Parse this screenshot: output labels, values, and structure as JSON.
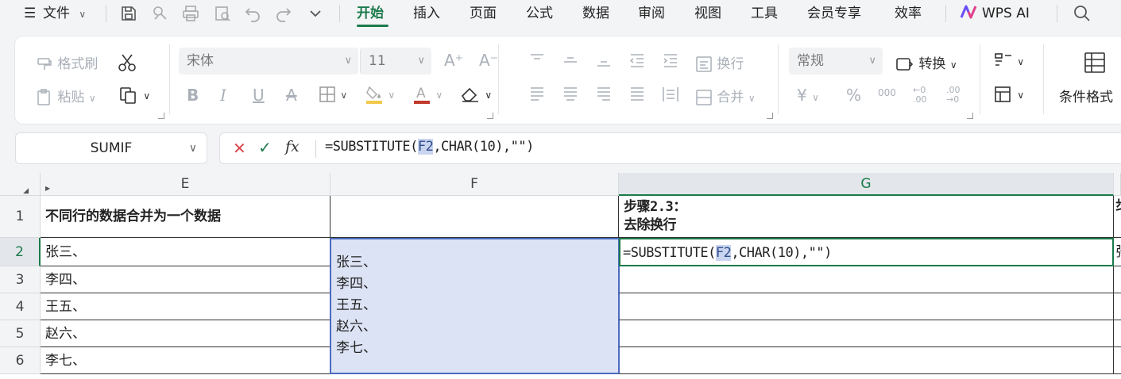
{
  "menubar": {
    "hamburger": "☰",
    "file": "文件",
    "tabs": [
      "开始",
      "插入",
      "页面",
      "公式",
      "数据",
      "审阅",
      "视图",
      "工具",
      "会员专享",
      "效率"
    ],
    "wps_ai": "WPS AI",
    "accent": "#1b7a4a"
  },
  "ribbon": {
    "format_painter": "格式刷",
    "paste": "粘贴",
    "font_name": "宋体",
    "font_size": "11",
    "wrap": "换行",
    "merge": "合并",
    "number_format": "常规",
    "convert": "转换",
    "conditional_format": "条件格式",
    "bold": "B",
    "italic": "I",
    "underline": "U",
    "strike": "A",
    "font_grow": "A⁺",
    "font_shrink": "A⁻",
    "currency": "¥",
    "percent": "%",
    "thousands": "000",
    "dec_inc": "←0 .00",
    "dec_dec": ".00 →0"
  },
  "namebox": {
    "value": "SUMIF"
  },
  "formula": {
    "p1": "=SUBSTITUTE(",
    "ref": "F2",
    "p2": ",CHAR(10),\"\")"
  },
  "columns": [
    "E",
    "F",
    "G"
  ],
  "rows": [
    "1",
    "2",
    "3",
    "4",
    "5",
    "6"
  ],
  "cells": {
    "E1": "不同行的数据合并为一个数据",
    "E2": "张三、",
    "E3": "李四、",
    "E4": "王五、",
    "E5": "赵六、",
    "E6": "李七、",
    "F2": [
      "张三、",
      "李四、",
      "王五、",
      "赵六、",
      "李七、"
    ],
    "G1_line1": "步骤2.3：",
    "G1_line2": "去除换行",
    "G2_p1": "=SUBSTITUTE(",
    "G2_ref": "F2",
    "G2_p2": ",CHAR(10),\"\")",
    "H1_partial": "步",
    "H2_partial": "张"
  }
}
